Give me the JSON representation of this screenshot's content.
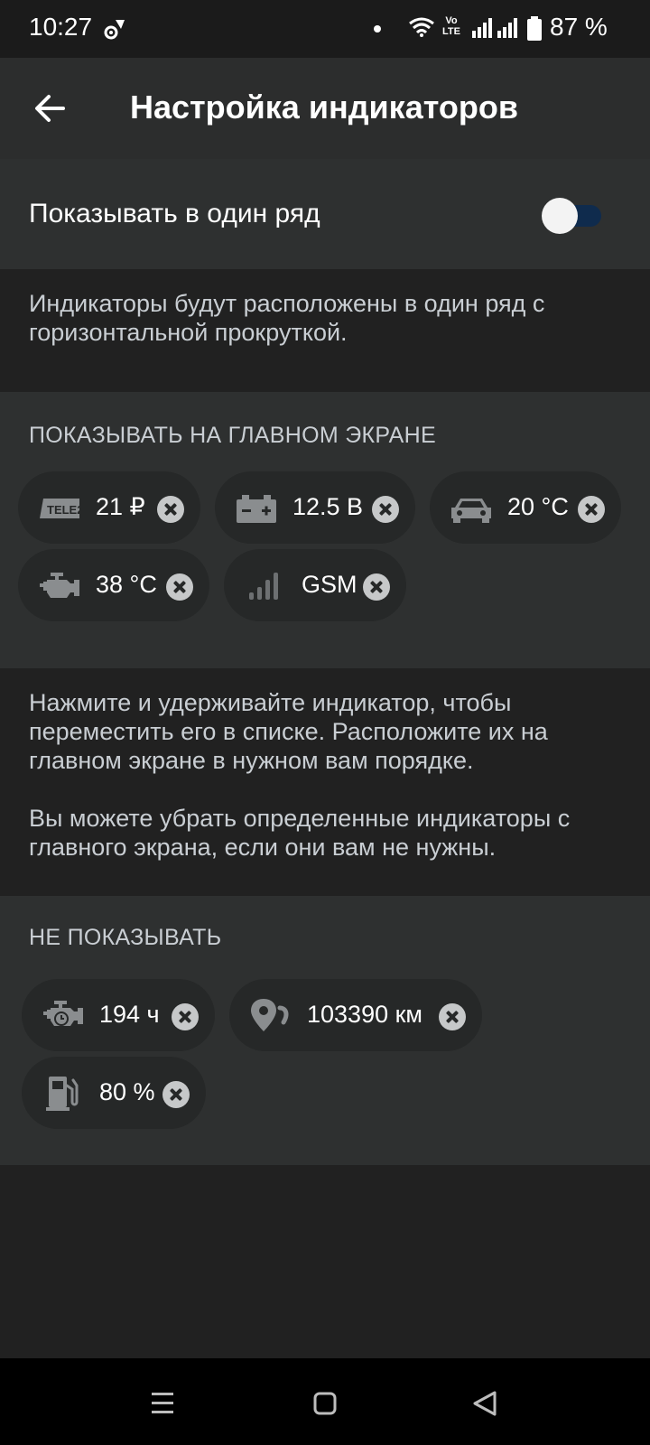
{
  "status_bar": {
    "time": "10:27",
    "battery_text": "87 %",
    "volte": "Vo LTE",
    "icons": [
      "settings-sync-icon",
      "notification-dot-icon",
      "wifi-icon",
      "volte-icon",
      "signal-icon",
      "signal-icon",
      "battery-icon"
    ]
  },
  "header": {
    "title": "Настройка индикаторов",
    "back_icon": "arrow-left-icon"
  },
  "single_row": {
    "label": "Показывать в один ряд",
    "enabled": false
  },
  "single_row_hint": "Индикаторы будут расположены в один ряд с горизонтальной прокруткой.",
  "show_section": {
    "title": "ПОКАЗЫВАТЬ НА ГЛАВНОМ ЭКРАНЕ",
    "chips": [
      {
        "icon": "tele2-icon",
        "value": "21 ₽"
      },
      {
        "icon": "car-battery-icon",
        "value": "12.5 В"
      },
      {
        "icon": "car-icon",
        "value": "20 °C"
      },
      {
        "icon": "engine-icon",
        "value": "38 °C"
      },
      {
        "icon": "signal-strength-icon",
        "value": "GSM"
      }
    ]
  },
  "hints": {
    "reorder": "Нажмите и удерживайте индикатор, чтобы переместить его в списке. Расположите их на главном экране в нужном вам порядке.",
    "remove": "Вы можете убрать определенные индикаторы с главного экрана, если они вам не нужны."
  },
  "hide_section": {
    "title": "НЕ ПОКАЗЫВАТЬ",
    "chips": [
      {
        "icon": "engine-hours-icon",
        "value": "194 ч"
      },
      {
        "icon": "mileage-pin-icon",
        "value": "103390 км"
      },
      {
        "icon": "fuel-icon",
        "value": "80 %"
      }
    ]
  },
  "nav_bar": {
    "icons": [
      "recent-apps-icon",
      "home-icon",
      "back-triangle-icon"
    ]
  },
  "colors": {
    "background": "#212121",
    "section": "#2e3030",
    "chip": "#262828",
    "toggle_track": "#0f2b4d",
    "hint_text": "#c9ced3"
  }
}
